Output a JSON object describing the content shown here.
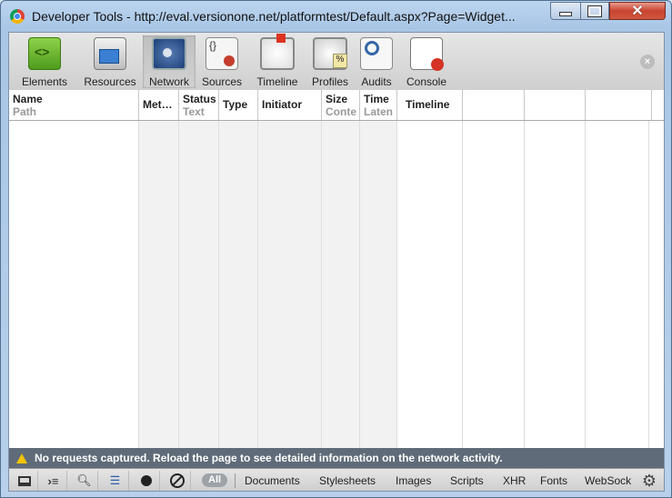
{
  "window": {
    "title": "Developer Tools - http://eval.versionone.net/platformtest/Default.aspx?Page=Widget...",
    "controls": {
      "minimize": "minimize-icon",
      "maximize": "maximize-icon",
      "close": "✕"
    }
  },
  "toolbar": {
    "tabs": [
      {
        "label": "Elements",
        "icon": "elements-icon"
      },
      {
        "label": "Resources",
        "icon": "resources-icon"
      },
      {
        "label": "Network",
        "icon": "network-icon",
        "selected": true
      },
      {
        "label": "Sources",
        "icon": "sources-icon"
      },
      {
        "label": "Timeline",
        "icon": "timeline-icon"
      },
      {
        "label": "Profiles",
        "icon": "profiles-icon"
      },
      {
        "label": "Audits",
        "icon": "audits-icon"
      },
      {
        "label": "Console",
        "icon": "console-icon"
      }
    ],
    "close_symbol": "×"
  },
  "network": {
    "columns": [
      {
        "title": "Name",
        "subtitle": "Path"
      },
      {
        "title": "Met…",
        "subtitle": ""
      },
      {
        "title": "Status",
        "subtitle": "Text"
      },
      {
        "title": "Type",
        "subtitle": ""
      },
      {
        "title": "Initiator",
        "subtitle": ""
      },
      {
        "title": "Size",
        "subtitle": "Conte"
      },
      {
        "title": "Time",
        "subtitle": "Laten"
      },
      {
        "title": "Timeline",
        "subtitle": ""
      }
    ],
    "rows": [],
    "status_message": "No requests captured. Reload the page to see detailed information on the network activity."
  },
  "bottombar": {
    "filters": [
      "All",
      "Documents",
      "Stylesheets",
      "Images",
      "Scripts",
      "XHR",
      "Fonts",
      "WebSock"
    ],
    "active_filter": "All",
    "settings_symbol": "⚙"
  },
  "colors": {
    "status_bar": "#5f6b78",
    "window_frame": "#bcd5ef",
    "close_button": "#c8442f"
  }
}
